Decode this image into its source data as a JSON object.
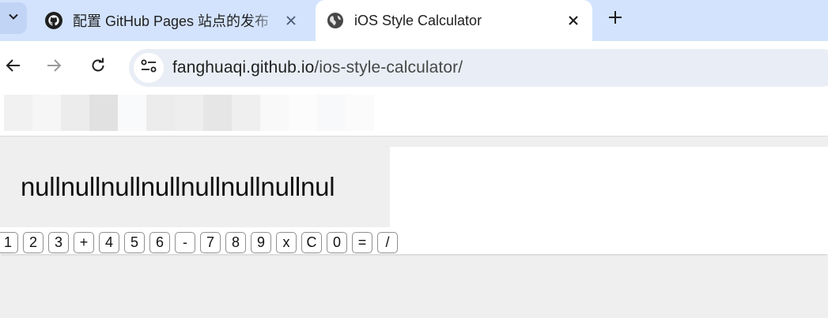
{
  "browser": {
    "tabs": [
      {
        "title": "配置 GitHub Pages 站点的发布",
        "icon": "github-icon",
        "active": false
      },
      {
        "title": "iOS Style Calculator",
        "icon": "globe-icon",
        "active": true
      }
    ],
    "tabstrip_color": "#d3e3fd",
    "address_bar": {
      "host": "fanghuaqi.github.io",
      "path": "/ios-style-calculator/",
      "icon": "site-settings-icon"
    }
  },
  "calculator": {
    "display": "nullnullnullnullnullnullnullnul",
    "keys": [
      "1",
      "2",
      "3",
      "+",
      "4",
      "5",
      "6",
      "-",
      "7",
      "8",
      "9",
      "x",
      "C",
      "0",
      "=",
      "/"
    ]
  },
  "placeholder_pixels": [
    "#f1f1f1",
    "#f6f6f6",
    "#ececec",
    "#e1e1e1",
    "#f9fafb",
    "#ececec",
    "#eeeeee",
    "#e6e6e6",
    "#efefef",
    "#f9f9f9",
    "#fcfcfc",
    "#f8f9fa",
    "#fbfbfb"
  ]
}
